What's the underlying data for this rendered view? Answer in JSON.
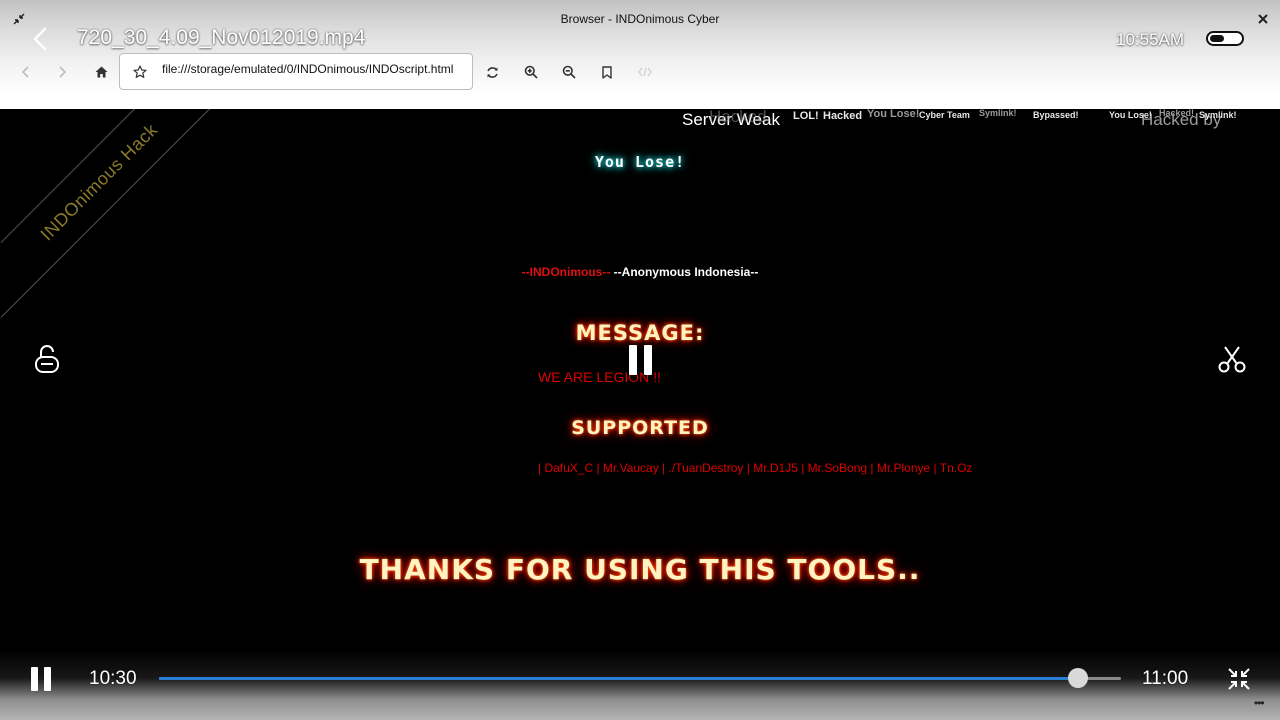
{
  "window": {
    "title": "Browser - INDOnimous Cyber"
  },
  "player": {
    "title": "720_30_4.09_Nov012019.mp4",
    "clock": "10:55AM",
    "battery_level": 0.45,
    "current_time": "10:30",
    "total_time": "11:00",
    "progress": 0.955
  },
  "browser": {
    "url": "file:///storage/emulated/0/INDOnimous/INDOscript.html"
  },
  "page": {
    "ribbon": "INDOnimous Hack",
    "ticker_large": [
      "Server Weak",
      "Hacked",
      "Hacked by"
    ],
    "ticker_small": [
      "LOL!",
      "Hacked",
      "You Lose!",
      "Cyber Team",
      "Symlink!",
      "Bypassed!",
      "You Lose!",
      "Hacked!",
      "Symlink!"
    ],
    "you_lose": "You Lose!",
    "team_red": "--INDOnimous--",
    "team_white": "--Anonymous Indonesia--",
    "message_heading": "MESSAGE:",
    "message_text": "WE ARE LEGION !!",
    "supported_heading": "SUPPORTED",
    "supporters": "| DafuX_C | Mr.Vaucay | ./TuanDestroy | Mr.D1J5 | Mr.SoBong | Mr.Plonye | Tn.Oz",
    "thanks": "THANKS FOR USING THIS TOOLS.."
  },
  "colors": {
    "progress_fill": "#2b7fd6",
    "text_red": "#e01010",
    "glow": "#e00000"
  },
  "icons": {
    "window_left": "shrink-arrows-icon",
    "window_right": "close-icon",
    "back": "chevron-left-icon",
    "nav": [
      "arrow-back-icon",
      "arrow-forward-icon",
      "home-icon",
      "star-icon",
      "refresh-icon",
      "zoom-in-icon",
      "zoom-out-icon",
      "bookmark-icon",
      "code-icon"
    ],
    "left_side": "unlock-icon",
    "right_side": "scissors-icon",
    "exit_fullscreen": "exit-fullscreen-icon"
  }
}
